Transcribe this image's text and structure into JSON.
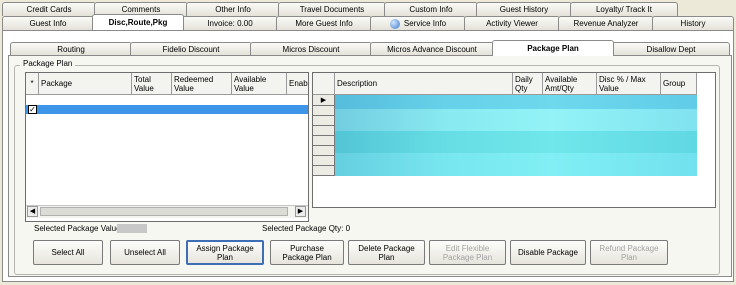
{
  "tabs_row1": [
    "Credit Cards",
    "Comments",
    "Other Info",
    "Travel Documents",
    "Custom Info",
    "Guest History",
    "Loyalty/ Track It"
  ],
  "tabs_row2": [
    "Guest Info",
    "Disc,Route,Pkg",
    "Invoice: 0.00",
    "More Guest Info",
    "Service Info",
    "Activity Viewer",
    "Revenue Analyzer",
    "History"
  ],
  "subtabs": [
    "Routing",
    "Fidelio Discount",
    "Micros Discount",
    "Micros Advance Discount",
    "Package Plan",
    "Disallow Dept"
  ],
  "group_title": "Package Plan",
  "left_grid": {
    "columns": [
      "*",
      "Package",
      "Total Value",
      "Redeemed Value",
      "Available Value",
      "Enable"
    ]
  },
  "right_grid": {
    "columns": [
      "Description",
      "Daily Qty",
      "Available Amt/Qty",
      "Disc % / Max Value",
      "Group"
    ]
  },
  "selected_value_label": "Selected Package Value:",
  "selected_qty_label": "Selected Package Qty: 0",
  "buttons": {
    "select_all": "Select All",
    "unselect_all": "Unselect All",
    "assign": "Assign Package Plan",
    "purchase": "Purchase Package Plan",
    "delete": "Delete Package Plan",
    "edit_flexible": "Edit Flexible Package Plan",
    "disable": "Disable Package",
    "refund": "Refund Package Plan"
  },
  "colors": {
    "selected_row": "#3c95e6",
    "cyan_grid": "#6ee9f2",
    "active_tab": "#ffffff"
  }
}
